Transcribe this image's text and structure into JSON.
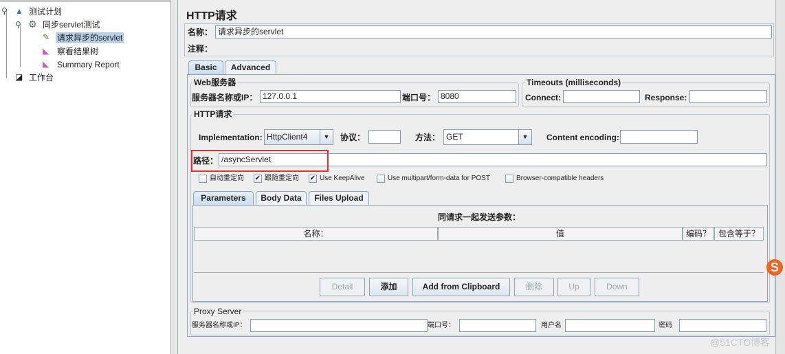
{
  "tree": {
    "items": [
      {
        "label": "测试计划",
        "icon": "test-plan-flask-icon"
      },
      {
        "label": "同步servlet测试",
        "icon": "thread-group-gear-icon"
      },
      {
        "label": "请求异步的servlet",
        "icon": "sampler-pipette-icon",
        "selected": true
      },
      {
        "label": "察看结果树",
        "icon": "listener-graph-icon"
      },
      {
        "label": "Summary Report",
        "icon": "listener-graph-icon"
      },
      {
        "label": "工作台",
        "icon": "workbench-icon"
      }
    ]
  },
  "panel": {
    "title": "HTTP请求",
    "name_label": "名称：",
    "name_value": "请求异步的servlet",
    "comment_label": "注释：",
    "comment_value": ""
  },
  "tabs": [
    "Basic",
    "Advanced"
  ],
  "web_server": {
    "title": "Web服务器",
    "server_label": "服务器名称或IP：",
    "server_value": "127.0.0.1",
    "port_label": "端口号：",
    "port_value": "8080"
  },
  "timeouts": {
    "title": "Timeouts (milliseconds)",
    "connect_label": "Connect:",
    "connect_value": "",
    "response_label": "Response:",
    "response_value": ""
  },
  "http": {
    "title": "HTTP请求",
    "impl_label": "Implementation:",
    "impl_value": "HttpClient4",
    "protocol_label": "协议：",
    "protocol_value": "",
    "method_label": "方法：",
    "method_value": "GET",
    "encoding_label": "Content encoding:",
    "encoding_value": "",
    "path_label": "路径：",
    "path_value": "/asyncServlet",
    "checkboxes": [
      {
        "label": "自动重定向",
        "checked": false
      },
      {
        "label": "跟随重定向",
        "checked": true
      },
      {
        "label": "Use KeepAlive",
        "checked": true
      },
      {
        "label": "Use multipart/form-data for POST",
        "checked": false
      },
      {
        "label": "Browser-compatible headers",
        "checked": false
      }
    ]
  },
  "inner_tabs": [
    "Parameters",
    "Body Data",
    "Files Upload"
  ],
  "params": {
    "caption": "同请求一起发送参数：",
    "columns": [
      "名称：",
      "值",
      "编码？",
      "包含等于？"
    ]
  },
  "buttons": {
    "detail": "Detail",
    "add": "添加",
    "clipboard": "Add from Clipboard",
    "delete": "删除",
    "up": "Up",
    "down": "Down"
  },
  "proxy": {
    "title": "Proxy Server",
    "server_label": "服务器名称或IP：",
    "port_label": "端口号：",
    "user_label": "用户名",
    "password_label": "密码"
  },
  "watermark": "@51CTO博客",
  "colors": {
    "highlight_box": "#e03030",
    "selection": "#b8cfe5"
  }
}
